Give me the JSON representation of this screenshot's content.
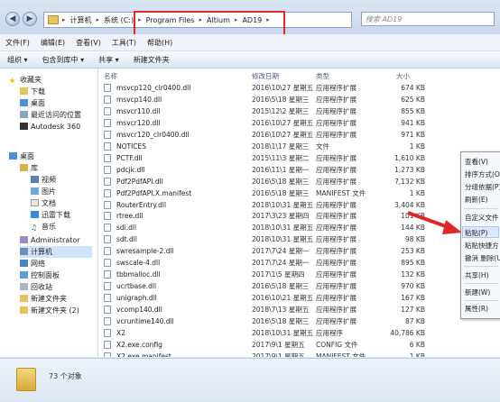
{
  "address": {
    "crumbs": [
      "计算机",
      "系统 (C:)",
      "Program Files",
      "Altium",
      "AD19"
    ],
    "search_placeholder": "搜索 AD19"
  },
  "menu": [
    "文件(F)",
    "编辑(E)",
    "查看(V)",
    "工具(T)",
    "帮助(H)"
  ],
  "toolbar": [
    "组织 ▾",
    "包含到库中 ▾",
    "共享 ▾",
    "新建文件夹"
  ],
  "sidebar": {
    "favorites": "收藏夹",
    "fav_items": [
      "下载",
      "桌面",
      "最近访问的位置",
      "Autodesk 360"
    ],
    "desktop": "桌面",
    "library": "库",
    "lib_items": [
      "视频",
      "图片",
      "文档",
      "迅雷下载",
      "音乐"
    ],
    "admin": "Administrator",
    "computer": "计算机",
    "network": "网络",
    "control_panel": "控制面板",
    "recycle": "回收站",
    "new_folder": "新建文件夹",
    "new_folder2": "新建文件夹 (2)"
  },
  "columns": {
    "name": "名称",
    "date": "修改日期",
    "type": "类型",
    "size": "大小"
  },
  "files": [
    {
      "name": "msvcp120_clr0400.dll",
      "date": "2016\\10\\27 星期五",
      "type": "应用程序扩展",
      "size": "674 KB"
    },
    {
      "name": "msvcp140.dll",
      "date": "2016\\5\\18 星期三",
      "type": "应用程序扩展",
      "size": "625 KB"
    },
    {
      "name": "msvcr110.dll",
      "date": "2015\\12\\2 星期三",
      "type": "应用程序扩展",
      "size": "855 KB"
    },
    {
      "name": "msvcr120.dll",
      "date": "2016\\10\\27 星期五",
      "type": "应用程序扩展",
      "size": "941 KB"
    },
    {
      "name": "msvcr120_clr0400.dll",
      "date": "2016\\10\\27 星期五",
      "type": "应用程序扩展",
      "size": "971 KB"
    },
    {
      "name": "NOTICES",
      "date": "2018\\1\\17 星期三",
      "type": "文件",
      "size": "1 KB"
    },
    {
      "name": "PCTF.dll",
      "date": "2015\\11\\3 星期二",
      "type": "应用程序扩展",
      "size": "1,610 KB"
    },
    {
      "name": "pdcjk.dll",
      "date": "2016\\11\\1 星期一",
      "type": "应用程序扩展",
      "size": "1,273 KB"
    },
    {
      "name": "Pdf2PdfAPI.dll",
      "date": "2016\\5\\18 星期三",
      "type": "应用程序扩展",
      "size": "7,132 KB"
    },
    {
      "name": "Pdf2PdfAPI.X.manifest",
      "date": "2016\\5\\18 星期三",
      "type": "MANIFEST 文件",
      "size": "1 KB"
    },
    {
      "name": "RouterEntry.dll",
      "date": "2018\\10\\31 星期五",
      "type": "应用程序扩展",
      "size": "3,404 KB"
    },
    {
      "name": "rtree.dll",
      "date": "2017\\3\\23 星期四",
      "type": "应用程序扩展",
      "size": "101 KB"
    },
    {
      "name": "sdi.dll",
      "date": "2018\\10\\31 星期五",
      "type": "应用程序扩展",
      "size": "144 KB"
    },
    {
      "name": "sdt.dll",
      "date": "2018\\10\\31 星期五",
      "type": "应用程序扩展",
      "size": "98 KB"
    },
    {
      "name": "swresample-2.dll",
      "date": "2017\\7\\24 星期一",
      "type": "应用程序扩展",
      "size": "253 KB"
    },
    {
      "name": "swscale-4.dll",
      "date": "2017\\7\\24 星期一",
      "type": "应用程序扩展",
      "size": "895 KB"
    },
    {
      "name": "tbbmalloc.dll",
      "date": "2017\\1\\5 星期四",
      "type": "应用程序扩展",
      "size": "132 KB"
    },
    {
      "name": "ucrtbase.dll",
      "date": "2016\\5\\18 星期三",
      "type": "应用程序扩展",
      "size": "970 KB"
    },
    {
      "name": "unigraph.dll",
      "date": "2016\\10\\21 星期五",
      "type": "应用程序扩展",
      "size": "167 KB"
    },
    {
      "name": "vcomp140.dll",
      "date": "2018\\7\\13 星期五",
      "type": "应用程序扩展",
      "size": "127 KB"
    },
    {
      "name": "vcruntime140.dll",
      "date": "2016\\5\\18 星期三",
      "type": "应用程序扩展",
      "size": "87 KB"
    },
    {
      "name": "X2",
      "date": "2018\\10\\31 星期五",
      "type": "应用程序",
      "size": "40,786 KB"
    },
    {
      "name": "X2.exe.config",
      "date": "2017\\9\\1 星期五",
      "type": "CONFIG 文件",
      "size": "6 KB"
    },
    {
      "name": "X2.exe.manifest",
      "date": "2017\\9\\1 星期五",
      "type": "MANIFEST 文件",
      "size": "1 KB"
    }
  ],
  "status": {
    "count": "73 个对象"
  },
  "context_menu": [
    "查看(V)",
    "排序方式(O)",
    "分组依据(P)",
    "刷新(E)",
    "自定义文件",
    "粘贴(P)",
    "粘贴快捷方",
    "撤消 删除(U)",
    "共享(H)",
    "新建(W)",
    "属性(R)"
  ]
}
